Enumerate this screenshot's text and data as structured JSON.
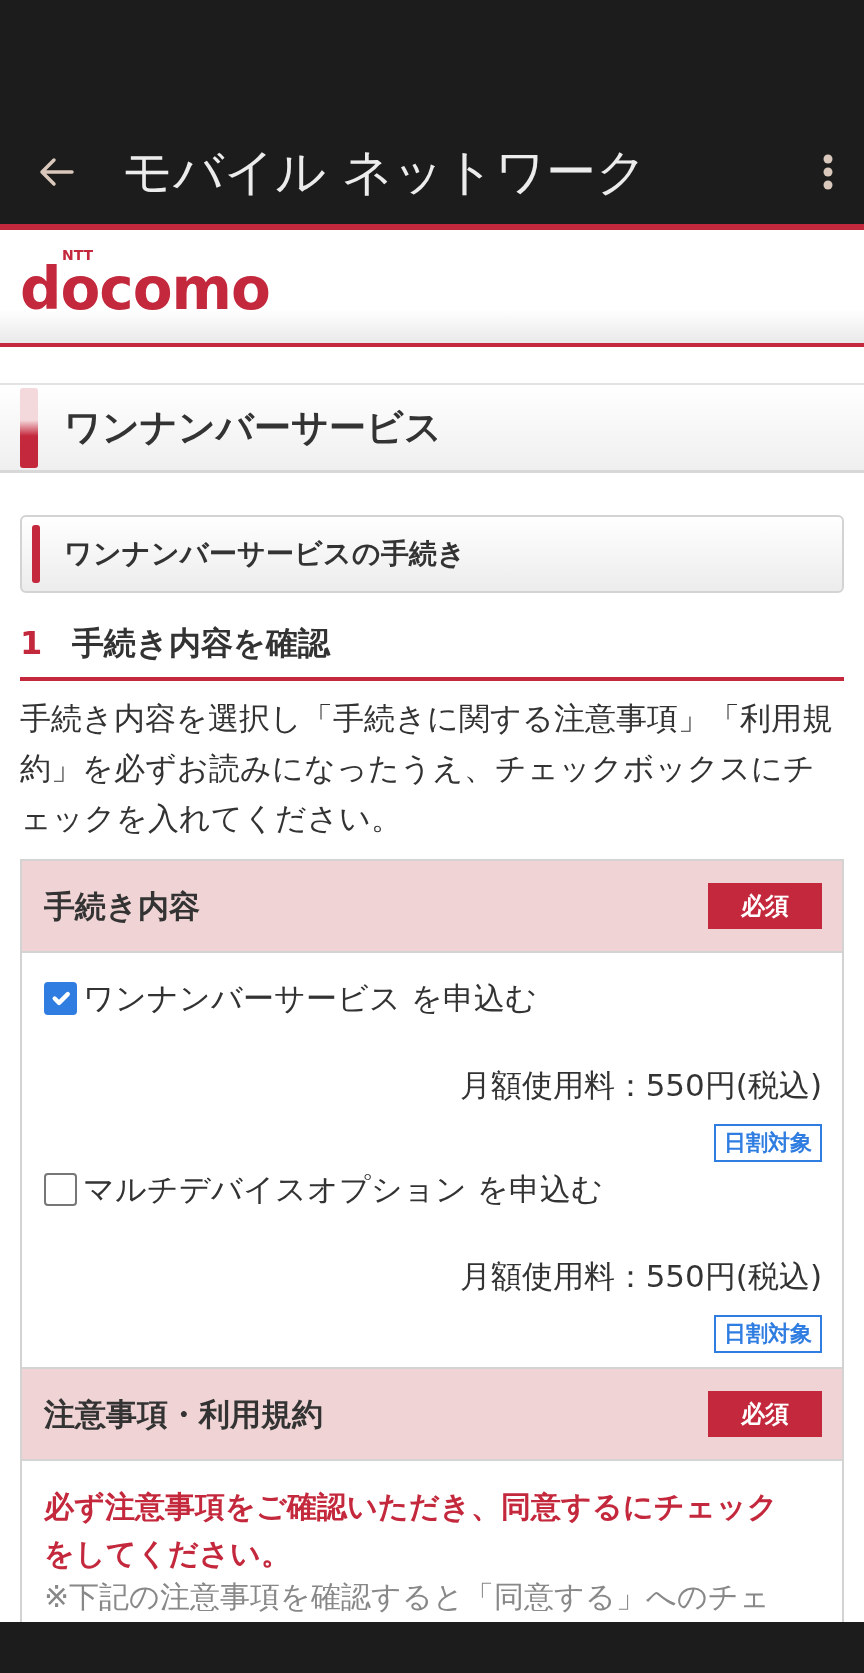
{
  "app_bar": {
    "title": "モバイル ネットワーク"
  },
  "logo": {
    "brand": "docomo",
    "mark": "NTT"
  },
  "page_title": "ワンナンバーサービス",
  "section_title": "ワンナンバーサービスの手続き",
  "step": {
    "number": "1",
    "title": "手続き内容を確認"
  },
  "intro": "手続き内容を選択し「手続きに関する注意事項」「利用規約」を必ずお読みになったうえ、チェックボックスにチェックを入れてください。",
  "panels": [
    {
      "kind": "options",
      "heading": "手続き内容",
      "badge": "必須",
      "options": [
        {
          "label": "ワンナンバーサービス を申込む",
          "checked": true,
          "fee": "月額使用料：550円(税込)",
          "tag": "日割対象"
        },
        {
          "label": "マルチデバイスオプション を申込む",
          "checked": false,
          "fee": "月額使用料：550円(税込)",
          "tag": "日割対象"
        }
      ]
    },
    {
      "kind": "notice",
      "heading": "注意事項・利用規約",
      "badge": "必須",
      "warning": "必ず注意事項をご確認いただき、同意するにチェックをしてください。",
      "note": "※下記の注意事項を確認すると「同意する」へのチェ"
    }
  ]
}
